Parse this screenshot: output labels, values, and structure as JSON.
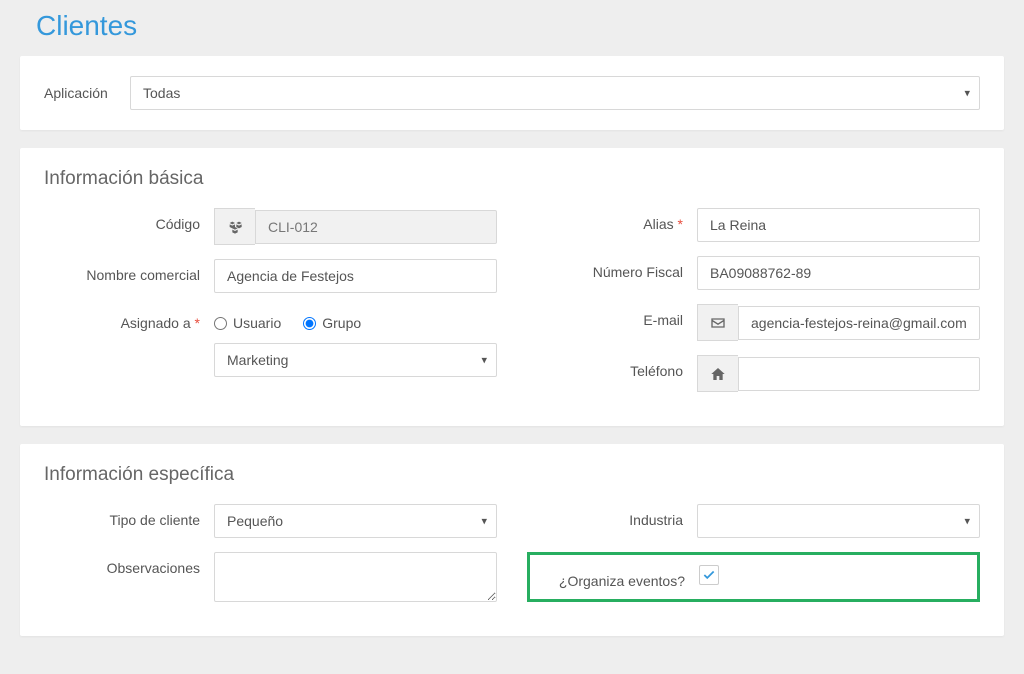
{
  "page": {
    "title": "Clientes"
  },
  "app_filter": {
    "label": "Aplicación",
    "selected": "Todas"
  },
  "basic": {
    "title": "Información básica",
    "codigo": {
      "label": "Código",
      "value": "CLI-012"
    },
    "nombre_comercial": {
      "label": "Nombre comercial",
      "value": "Agencia de Festejos"
    },
    "asignado": {
      "label": "Asignado a",
      "option_usuario": "Usuario",
      "option_grupo": "Grupo",
      "selected": "Grupo",
      "group_value": "Marketing"
    },
    "alias": {
      "label": "Alias",
      "value": "La Reina"
    },
    "numero_fiscal": {
      "label": "Número Fiscal",
      "value": "BA09088762-89"
    },
    "email": {
      "label": "E-mail",
      "value": "agencia-festejos-reina@gmail.com"
    },
    "telefono": {
      "label": "Teléfono",
      "value": ""
    }
  },
  "specific": {
    "title": "Información específica",
    "tipo_cliente": {
      "label": "Tipo de cliente",
      "value": "Pequeño"
    },
    "observaciones": {
      "label": "Observaciones",
      "value": ""
    },
    "industria": {
      "label": "Industria",
      "value": ""
    },
    "organiza_eventos": {
      "label": "¿Organiza eventos?",
      "checked": true
    }
  }
}
